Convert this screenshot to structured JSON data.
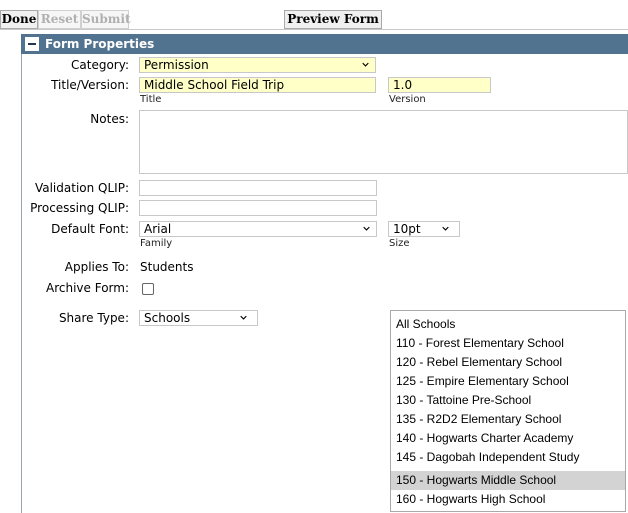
{
  "toolbar": {
    "done_label": "Done",
    "reset_label": "Reset",
    "submit_label": "Submit",
    "preview_label": "Preview Form"
  },
  "section": {
    "title": "Form Properties"
  },
  "form": {
    "category": {
      "label": "Category:",
      "value": "Permission"
    },
    "title_version": {
      "label": "Title/Version:",
      "title_value": "Middle School Field Trip",
      "title_sub": "Title",
      "version_value": "1.0",
      "version_sub": "Version"
    },
    "notes": {
      "label": "Notes:",
      "value": ""
    },
    "validation_qlip": {
      "label": "Validation QLIP:",
      "value": ""
    },
    "processing_qlip": {
      "label": "Processing QLIP:",
      "value": ""
    },
    "default_font": {
      "label": "Default Font:",
      "family_value": "Arial",
      "family_sub": "Family",
      "size_value": "10pt",
      "size_sub": "Size"
    },
    "applies_to": {
      "label": "Applies To:",
      "value": "Students"
    },
    "archive_form": {
      "label": "Archive Form:",
      "checked": false
    },
    "share_type": {
      "label": "Share Type:",
      "value": "Schools"
    }
  },
  "schools": {
    "items": [
      "All Schools",
      "110 - Forest Elementary School",
      "120 - Rebel Elementary School",
      "125 - Empire Elementary School",
      "130 - Tattoine Pre-School",
      "135 - R2D2 Elementary School",
      "140 - Hogwarts Charter Academy",
      "145 - Dagobah Independent Study",
      "150 - Hogwarts Middle School",
      "160 - Hogwarts High School"
    ],
    "selected": "150 - Hogwarts Middle School"
  },
  "colors": {
    "header_bg": "#52738f",
    "highlight_field": "#ffffc8",
    "selected_row": "#d3d3d3"
  }
}
